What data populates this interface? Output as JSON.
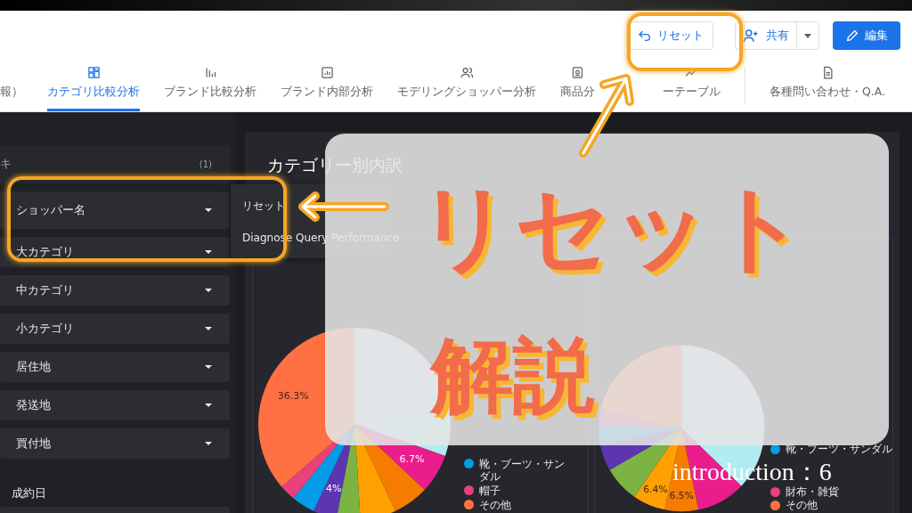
{
  "header": {
    "buttons": [
      {
        "kind": "reset",
        "label": "リセット"
      },
      {
        "kind": "share",
        "label": "共有"
      },
      {
        "kind": "edit",
        "label": "編集"
      }
    ]
  },
  "tabs": [
    {
      "label": "報）",
      "selected": false
    },
    {
      "label": "カテゴリ比較分析",
      "selected": true
    },
    {
      "label": "ブランド比較分析",
      "selected": false
    },
    {
      "label": "ブランド内部分析",
      "selected": false
    },
    {
      "label": "モデリングショッパー分析",
      "selected": false
    },
    {
      "label": "商品分",
      "selected": false
    },
    {
      "label": "ーテーブル",
      "selected": false
    },
    {
      "label": "各種問い合わせ・Q.A.",
      "selected": false
    }
  ],
  "filters": [
    {
      "kind": "count",
      "label": "キ",
      "count": "(1)"
    },
    {
      "kind": "dropdown",
      "label": "ショッパー名"
    },
    {
      "kind": "dropdown",
      "label": "大カテゴリ"
    },
    {
      "kind": "dropdown",
      "label": "中カテゴリ"
    },
    {
      "kind": "dropdown",
      "label": "小カテゴリ"
    },
    {
      "kind": "dropdown",
      "label": "居住地"
    },
    {
      "kind": "dropdown",
      "label": "発送地"
    },
    {
      "kind": "dropdown",
      "label": "買付地"
    }
  ],
  "date_filter": {
    "label": "成約日"
  },
  "context_menu": {
    "items": [
      "リセット",
      "Diagnose Query Performance"
    ]
  },
  "card": {
    "title": "カテゴリー別内訳",
    "pies": [
      {
        "slice_labels": [
          "6.7%",
          "4%",
          "36.3%"
        ],
        "legend": [
          {
            "name": "靴・ブーツ・サンダル",
            "color": "#039be5"
          },
          {
            "name": "帽子",
            "color": "#ec407a"
          },
          {
            "name": "その他",
            "color": "#ff7043"
          }
        ]
      },
      {
        "slice_labels": [
          "6.5%",
          "6.4%"
        ],
        "legend": [
          {
            "name": "靴・ブーツ・サンダル",
            "color": "#039be5"
          },
          {
            "name": "財布・雑貨",
            "color": "#ec407a"
          },
          {
            "name": "その他",
            "color": "#ff7043"
          }
        ]
      }
    ]
  },
  "overlay": {
    "headline": "リセット",
    "subhead": "解説",
    "footer": "introduction：6"
  }
}
